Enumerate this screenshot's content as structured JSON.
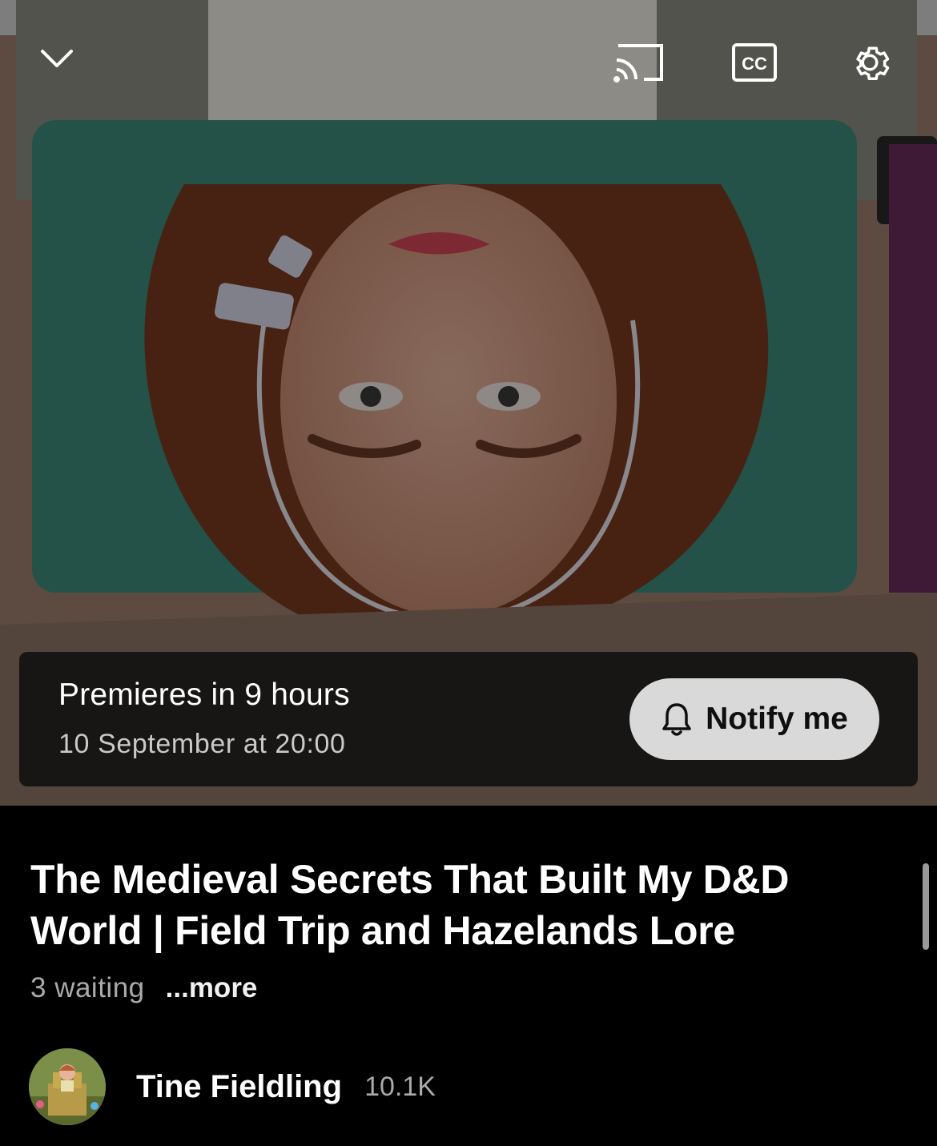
{
  "player": {
    "icons": {
      "collapse": "chevron-down-icon",
      "cast": "cast-icon",
      "captions": "closed-captions-icon",
      "settings": "gear-icon"
    },
    "captions_label": "CC",
    "premiere": {
      "title": "Premieres in 9 hours",
      "date": "10 September at 20:00",
      "notify_label": "Notify me",
      "notify_icon": "bell-icon"
    }
  },
  "video": {
    "title": "The Medieval Secrets That Built My D&D World | Field Trip and Hazelands Lore",
    "waiting": "3 waiting",
    "more_label": "...more"
  },
  "channel": {
    "name": "Tine Fieldling",
    "subscribers": "10.1K"
  },
  "colors": {
    "background": "#000000",
    "notify_button": "#d9d9d9",
    "secondary_text": "#aaaaaa"
  }
}
